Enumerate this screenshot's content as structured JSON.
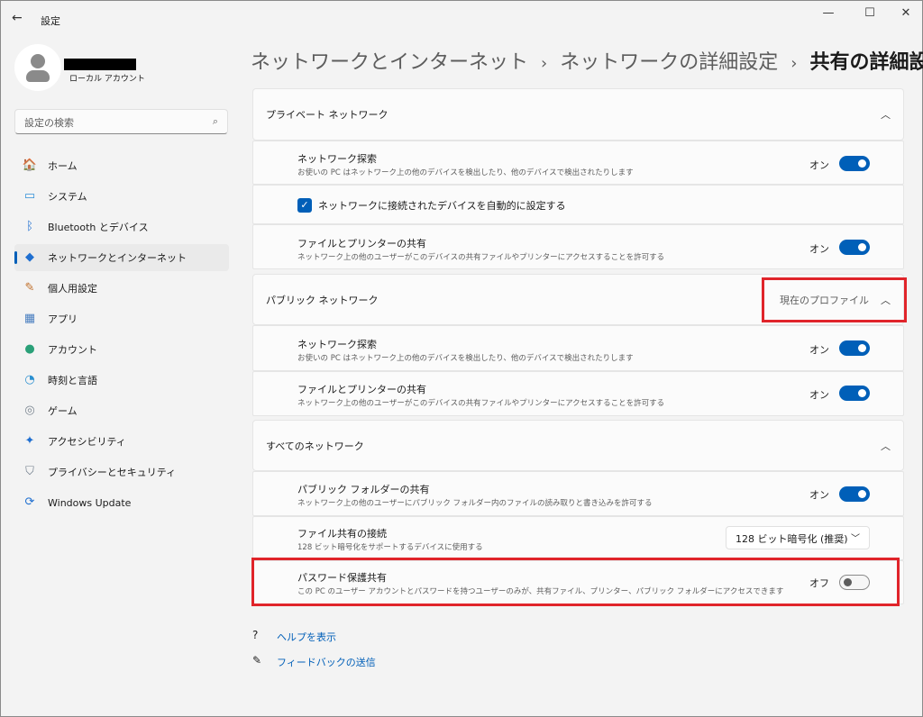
{
  "window": {
    "title": "設定",
    "minimize": "—",
    "maximize": "☐",
    "close": "✕"
  },
  "account": {
    "type": "ローカル アカウント"
  },
  "search": {
    "placeholder": "設定の検索"
  },
  "nav": [
    {
      "label": "ホーム",
      "icon": "🏠"
    },
    {
      "label": "システム",
      "icon": "▭"
    },
    {
      "label": "Bluetooth とデバイス",
      "icon": "ᛒ"
    },
    {
      "label": "ネットワークとインターネット",
      "icon": "◆"
    },
    {
      "label": "個人用設定",
      "icon": "✎"
    },
    {
      "label": "アプリ",
      "icon": "▦"
    },
    {
      "label": "アカウント",
      "icon": "●"
    },
    {
      "label": "時刻と言語",
      "icon": "◔"
    },
    {
      "label": "ゲーム",
      "icon": "◎"
    },
    {
      "label": "アクセシビリティ",
      "icon": "✦"
    },
    {
      "label": "プライバシーとセキュリティ",
      "icon": "⛉"
    },
    {
      "label": "Windows Update",
      "icon": "⟳"
    }
  ],
  "breadcrumb": [
    "ネットワークとインターネット",
    "ネットワークの詳細設定",
    "共有の詳細設定"
  ],
  "private": {
    "title": "プライベート ネットワーク",
    "discovery": {
      "title": "ネットワーク探索",
      "desc": "お使いの PC はネットワーク上の他のデバイスを検出したり、他のデバイスで検出されたりします",
      "state": "オン"
    },
    "auto": {
      "label": "ネットワークに接続されたデバイスを自動的に設定する"
    },
    "sharing": {
      "title": "ファイルとプリンターの共有",
      "desc": "ネットワーク上の他のユーザーがこのデバイスの共有ファイルやプリンターにアクセスすることを許可する",
      "state": "オン"
    }
  },
  "public": {
    "title": "パブリック ネットワーク",
    "badge": "現在のプロファイル",
    "discovery": {
      "title": "ネットワーク探索",
      "desc": "お使いの PC はネットワーク上の他のデバイスを検出したり、他のデバイスで検出されたりします",
      "state": "オン"
    },
    "sharing": {
      "title": "ファイルとプリンターの共有",
      "desc": "ネットワーク上の他のユーザーがこのデバイスの共有ファイルやプリンターにアクセスすることを許可する",
      "state": "オン"
    }
  },
  "all": {
    "title": "すべてのネットワーク",
    "publicfolder": {
      "title": "パブリック フォルダーの共有",
      "desc": "ネットワーク上の他のユーザーにパブリック フォルダー内のファイルの読み取りと書き込みを許可する",
      "state": "オン"
    },
    "connection": {
      "title": "ファイル共有の接続",
      "desc": "128 ビット暗号化をサポートするデバイスに使用する",
      "value": "128 ビット暗号化 (推奨)"
    },
    "password": {
      "title": "パスワード保護共有",
      "desc": "この PC のユーザー アカウントとパスワードを持つユーザーのみが、共有ファイル、プリンター、パブリック フォルダーにアクセスできます",
      "state": "オフ"
    }
  },
  "links": {
    "help": "ヘルプを表示",
    "feedback": "フィードバックの送信"
  }
}
